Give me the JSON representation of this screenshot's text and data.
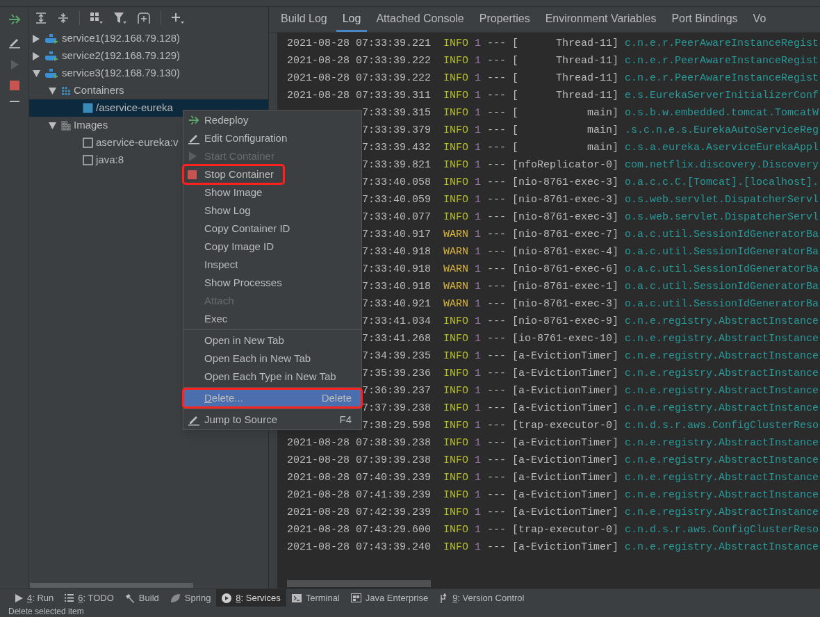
{
  "tree": [
    {
      "kind": "service",
      "label": "service1(192.168.79.128)",
      "expanded": false,
      "selected": false
    },
    {
      "kind": "service",
      "label": "service2(192.168.79.129)",
      "expanded": false,
      "selected": false
    },
    {
      "kind": "service",
      "label": "service3(192.168.79.130)",
      "expanded": true,
      "selected": false,
      "children": [
        {
          "kind": "containers",
          "label": "Containers",
          "expanded": true,
          "selected": false,
          "children": [
            {
              "kind": "container",
              "label": "/aservice-eureka",
              "selected": true
            }
          ]
        },
        {
          "kind": "images",
          "label": "Images",
          "expanded": true,
          "selected": false,
          "children": [
            {
              "kind": "image",
              "label": "aservice-eureka:v",
              "selected": false
            },
            {
              "kind": "image",
              "label": "java:8",
              "selected": false
            }
          ]
        }
      ]
    }
  ],
  "tabs": [
    {
      "label": "Build Log",
      "selected": false
    },
    {
      "label": "Log",
      "selected": true
    },
    {
      "label": "Attached Console",
      "selected": false
    },
    {
      "label": "Properties",
      "selected": false
    },
    {
      "label": "Environment Variables",
      "selected": false
    },
    {
      "label": "Port Bindings",
      "selected": false
    },
    {
      "label": "Vo",
      "selected": false
    }
  ],
  "log": [
    {
      "time": "2021-08-28 07:33:39.221",
      "level": "INFO",
      "pid": "1",
      "sep": "---",
      "thread": "[      Thread-11]",
      "logger": "c.n.e.r.PeerAwareInstanceRegist"
    },
    {
      "time": "2021-08-28 07:33:39.222",
      "level": "INFO",
      "pid": "1",
      "sep": "---",
      "thread": "[      Thread-11]",
      "logger": "c.n.e.r.PeerAwareInstanceRegist"
    },
    {
      "time": "2021-08-28 07:33:39.222",
      "level": "INFO",
      "pid": "1",
      "sep": "---",
      "thread": "[      Thread-11]",
      "logger": "c.n.e.r.PeerAwareInstanceRegist"
    },
    {
      "time": "2021-08-28 07:33:39.311",
      "level": "INFO",
      "pid": "1",
      "sep": "---",
      "thread": "[      Thread-11]",
      "logger": "e.s.EurekaServerInitializerConf"
    },
    {
      "time": "7:33:39.315",
      "level": "INFO",
      "pid": "1",
      "sep": "---",
      "thread": "[           main]",
      "logger": "o.s.b.w.embedded.tomcat.TomcatW"
    },
    {
      "time": "7:33:39.379",
      "level": "INFO",
      "pid": "1",
      "sep": "---",
      "thread": "[           main]",
      "logger": ".s.c.n.e.s.EurekaAutoServiceReg"
    },
    {
      "time": "7:33:39.432",
      "level": "INFO",
      "pid": "1",
      "sep": "---",
      "thread": "[           main]",
      "logger": "c.s.a.eureka.AserviceEurekaAppl"
    },
    {
      "time": "7:33:39.821",
      "level": "INFO",
      "pid": "1",
      "sep": "---",
      "thread": "[nfoReplicator-0]",
      "logger": "com.netflix.discovery.Discovery"
    },
    {
      "time": "7:33:40.058",
      "level": "INFO",
      "pid": "1",
      "sep": "---",
      "thread": "[nio-8761-exec-3]",
      "logger": "o.a.c.c.C.[Tomcat].[localhost]."
    },
    {
      "time": "7:33:40.059",
      "level": "INFO",
      "pid": "1",
      "sep": "---",
      "thread": "[nio-8761-exec-3]",
      "logger": "o.s.web.servlet.DispatcherServl"
    },
    {
      "time": "7:33:40.077",
      "level": "INFO",
      "pid": "1",
      "sep": "---",
      "thread": "[nio-8761-exec-3]",
      "logger": "o.s.web.servlet.DispatcherServl"
    },
    {
      "time": "7:33:40.917",
      "level": "WARN",
      "pid": "1",
      "sep": "---",
      "thread": "[nio-8761-exec-7]",
      "logger": "o.a.c.util.SessionIdGeneratorBa"
    },
    {
      "time": "7:33:40.918",
      "level": "WARN",
      "pid": "1",
      "sep": "---",
      "thread": "[nio-8761-exec-4]",
      "logger": "o.a.c.util.SessionIdGeneratorBa"
    },
    {
      "time": "7:33:40.918",
      "level": "WARN",
      "pid": "1",
      "sep": "---",
      "thread": "[nio-8761-exec-6]",
      "logger": "o.a.c.util.SessionIdGeneratorBa"
    },
    {
      "time": "7:33:40.918",
      "level": "WARN",
      "pid": "1",
      "sep": "---",
      "thread": "[nio-8761-exec-1]",
      "logger": "o.a.c.util.SessionIdGeneratorBa"
    },
    {
      "time": "7:33:40.921",
      "level": "WARN",
      "pid": "1",
      "sep": "---",
      "thread": "[nio-8761-exec-3]",
      "logger": "o.a.c.util.SessionIdGeneratorBa"
    },
    {
      "time": "7:33:41.034",
      "level": "INFO",
      "pid": "1",
      "sep": "---",
      "thread": "[nio-8761-exec-9]",
      "logger": "c.n.e.registry.AbstractInstance"
    },
    {
      "time": "7:33:41.268",
      "level": "INFO",
      "pid": "1",
      "sep": "---",
      "thread": "[io-8761-exec-10]",
      "logger": "c.n.e.registry.AbstractInstance"
    },
    {
      "time": "7:34:39.235",
      "level": "INFO",
      "pid": "1",
      "sep": "---",
      "thread": "[a-EvictionTimer]",
      "logger": "c.n.e.registry.AbstractInstance"
    },
    {
      "time": "7:35:39.236",
      "level": "INFO",
      "pid": "1",
      "sep": "---",
      "thread": "[a-EvictionTimer]",
      "logger": "c.n.e.registry.AbstractInstance"
    },
    {
      "time": "7:36:39.237",
      "level": "INFO",
      "pid": "1",
      "sep": "---",
      "thread": "[a-EvictionTimer]",
      "logger": "c.n.e.registry.AbstractInstance"
    },
    {
      "time": "7:37:39.238",
      "level": "INFO",
      "pid": "1",
      "sep": "---",
      "thread": "[a-EvictionTimer]",
      "logger": "c.n.e.registry.AbstractInstance"
    },
    {
      "time": "7:38:29.598",
      "level": "INFO",
      "pid": "1",
      "sep": "---",
      "thread": "[trap-executor-0]",
      "logger": "c.n.d.s.r.aws.ConfigClusterReso"
    },
    {
      "time": "2021-08-28 07:38:39.238",
      "level": "INFO",
      "pid": "1",
      "sep": "---",
      "thread": "[a-EvictionTimer]",
      "logger": "c.n.e.registry.AbstractInstance"
    },
    {
      "time": "2021-08-28 07:39:39.238",
      "level": "INFO",
      "pid": "1",
      "sep": "---",
      "thread": "[a-EvictionTimer]",
      "logger": "c.n.e.registry.AbstractInstance"
    },
    {
      "time": "2021-08-28 07:40:39.239",
      "level": "INFO",
      "pid": "1",
      "sep": "---",
      "thread": "[a-EvictionTimer]",
      "logger": "c.n.e.registry.AbstractInstance"
    },
    {
      "time": "2021-08-28 07:41:39.239",
      "level": "INFO",
      "pid": "1",
      "sep": "---",
      "thread": "[a-EvictionTimer]",
      "logger": "c.n.e.registry.AbstractInstance"
    },
    {
      "time": "2021-08-28 07:42:39.239",
      "level": "INFO",
      "pid": "1",
      "sep": "---",
      "thread": "[a-EvictionTimer]",
      "logger": "c.n.e.registry.AbstractInstance"
    },
    {
      "time": "2021-08-28 07:43:29.600",
      "level": "INFO",
      "pid": "1",
      "sep": "---",
      "thread": "[trap-executor-0]",
      "logger": "c.n.d.s.r.aws.ConfigClusterReso"
    },
    {
      "time": "2021-08-28 07:43:39.240",
      "level": "INFO",
      "pid": "1",
      "sep": "---",
      "thread": "[a-EvictionTimer]",
      "logger": "c.n.e.registry.AbstractInstance"
    }
  ],
  "context_menu": [
    {
      "kind": "item",
      "label": "Redeploy",
      "disabled": false,
      "selected": false,
      "annotated": false
    },
    {
      "kind": "item",
      "label": "Edit Configuration",
      "disabled": false,
      "selected": false,
      "annotated": false
    },
    {
      "kind": "item",
      "label": "Start Container",
      "disabled": true,
      "selected": false,
      "annotated": false
    },
    {
      "kind": "item",
      "label": "Stop Container",
      "disabled": false,
      "selected": false,
      "annotated": true
    },
    {
      "kind": "item",
      "label": "Show Image",
      "disabled": false,
      "selected": false,
      "annotated": false
    },
    {
      "kind": "item",
      "label": "Show Log",
      "disabled": false,
      "selected": false,
      "annotated": false
    },
    {
      "kind": "item",
      "label": "Copy Container ID",
      "disabled": false,
      "selected": false,
      "annotated": false
    },
    {
      "kind": "item",
      "label": "Copy Image ID",
      "disabled": false,
      "selected": false,
      "annotated": false
    },
    {
      "kind": "item",
      "label": "Inspect",
      "disabled": false,
      "selected": false,
      "annotated": false
    },
    {
      "kind": "item",
      "label": "Show Processes",
      "disabled": false,
      "selected": false,
      "annotated": false
    },
    {
      "kind": "item",
      "label": "Attach",
      "disabled": true,
      "selected": false,
      "annotated": false
    },
    {
      "kind": "item",
      "label": "Exec",
      "disabled": false,
      "selected": false,
      "annotated": false
    },
    {
      "kind": "separator"
    },
    {
      "kind": "item",
      "label": "Open in New Tab",
      "disabled": false,
      "selected": false,
      "annotated": false
    },
    {
      "kind": "item",
      "label": "Open Each in New Tab",
      "disabled": false,
      "selected": false,
      "annotated": false
    },
    {
      "kind": "item",
      "label": "Open Each Type in New Tab",
      "disabled": false,
      "selected": false,
      "annotated": false
    },
    {
      "kind": "separator"
    },
    {
      "kind": "item",
      "label": "Delete...",
      "mnemonic": true,
      "shortcut": "Delete",
      "disabled": false,
      "selected": true,
      "annotated": true
    },
    {
      "kind": "separator"
    },
    {
      "kind": "item",
      "label": "Jump to Source",
      "shortcut": "F4",
      "disabled": false,
      "selected": false,
      "annotated": false
    }
  ],
  "tool_windows": [
    {
      "label": "4: Run",
      "mnemonic": true,
      "selected": false
    },
    {
      "label": "6: TODO",
      "mnemonic": true,
      "selected": false
    },
    {
      "label": "Build",
      "mnemonic": false,
      "selected": false
    },
    {
      "label": "Spring",
      "mnemonic": false,
      "selected": false
    },
    {
      "label": "8: Services",
      "mnemonic": true,
      "selected": true
    },
    {
      "label": "Terminal",
      "mnemonic": false,
      "selected": false
    },
    {
      "label": "Java Enterprise",
      "mnemonic": false,
      "selected": false
    },
    {
      "label": "9: Version Control",
      "mnemonic": true,
      "selected": false
    }
  ],
  "status_bar": "Delete selected item"
}
